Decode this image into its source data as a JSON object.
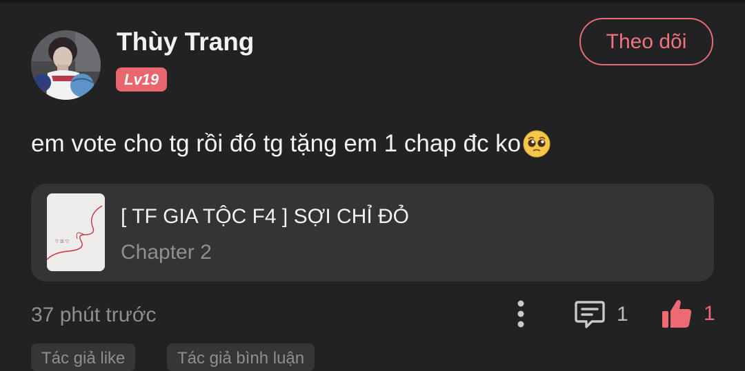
{
  "comment": {
    "user": {
      "name": "Thùy Trang",
      "level": "Lv19",
      "avatar_icon": "user-avatar-photo"
    },
    "follow_button_label": "Theo dõi",
    "text": "em vote cho tg rồi đó tg tặng em 1 chap đc ko",
    "emoji": "pleading-face-emoji",
    "linked_chapter": {
      "story_title": "[ TF GIA TỘC F4 ] SỢI CHỈ ĐỎ",
      "chapter": "Chapter 2",
      "cover_icon": "red-thread-cover"
    },
    "timestamp": "37 phút trước",
    "actions": {
      "more_icon": "vertical-dots-icon",
      "reply_icon": "comment-bubble-icon",
      "reply_count": "1",
      "like_icon": "thumbs-up-icon",
      "like_count": "1"
    },
    "tags": [
      "Tác giả like",
      "Tác giả bình luận"
    ]
  },
  "colors": {
    "background": "#222123",
    "accent": "#e8666e",
    "card": "#343335",
    "muted_text": "#8f8f92"
  }
}
